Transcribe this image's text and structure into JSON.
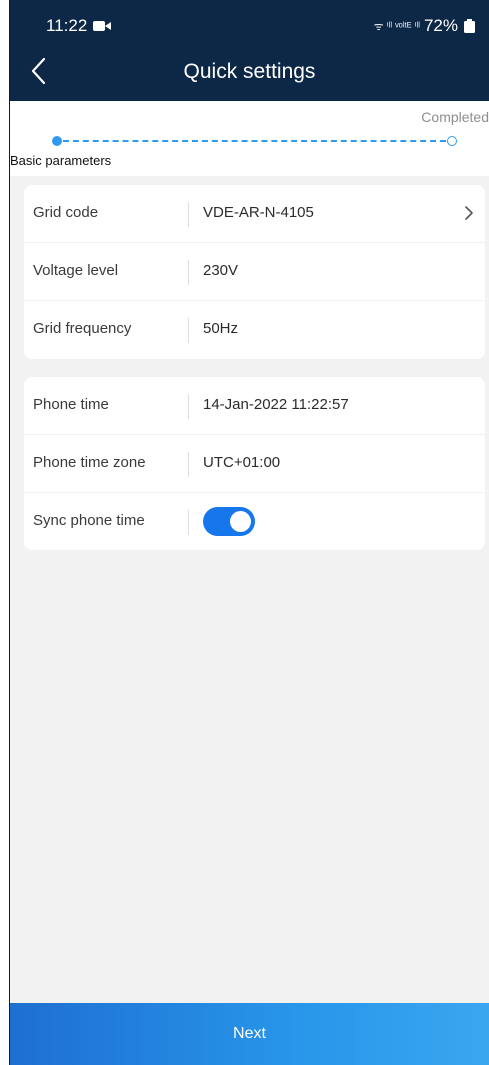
{
  "status_bar": {
    "time": "11:22",
    "signal_text": "ᯤ ⁱˡˡ ᵛᵒˡᵗᴱ ⁱˡˡ",
    "battery": "72%"
  },
  "header": {
    "title": "Quick settings"
  },
  "progress": {
    "current_step": "Basic parameters",
    "final_step": "Completed"
  },
  "grid_settings": {
    "grid_code_label": "Grid code",
    "grid_code_value": "VDE-AR-N-4105",
    "voltage_label": "Voltage level",
    "voltage_value": "230V",
    "frequency_label": "Grid frequency",
    "frequency_value": "50Hz"
  },
  "time_settings": {
    "phone_time_label": "Phone time",
    "phone_time_value": "14-Jan-2022 11:22:57",
    "timezone_label": "Phone time zone",
    "timezone_value": "UTC+01:00",
    "sync_label": "Sync phone time",
    "sync_on": true
  },
  "footer": {
    "next_label": "Next"
  },
  "colors": {
    "header_bg": "#0d2847",
    "accent": "#2f9bf0",
    "toggle_on": "#1677ed"
  }
}
